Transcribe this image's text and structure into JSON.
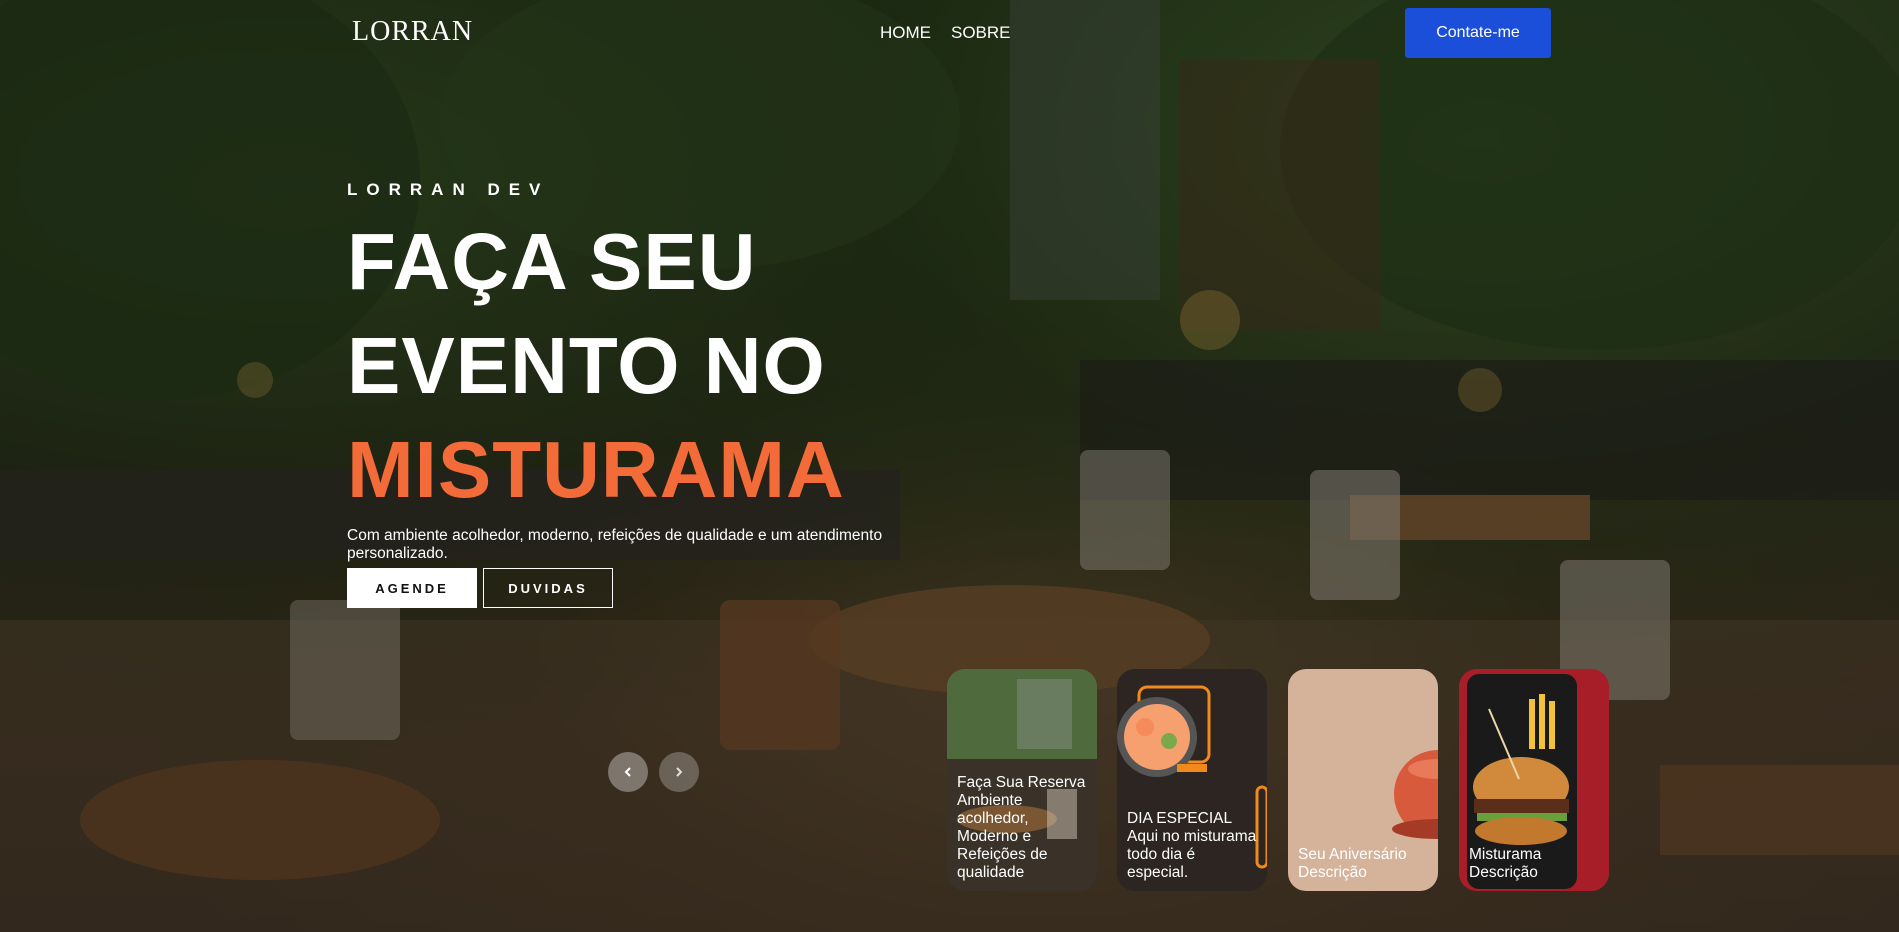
{
  "brand": {
    "logo": "LORRAN"
  },
  "nav": {
    "items": [
      "HOME",
      "SOBRE"
    ],
    "contact_label": "Contate-me"
  },
  "hero": {
    "eyebrow": "LORRAN DEV",
    "headline_line1": "FAÇA SEU",
    "headline_line2": "EVENTO NO",
    "headline_accent": "MISTURAMA",
    "description": "Com ambiente acolhedor, moderno, refeições de qualidade e um atendimento personalizado.",
    "primary_button": "AGENDE",
    "secondary_button": "DUVIDAS"
  },
  "slider": {
    "prev_icon": "chevron-left-icon",
    "next_icon": "chevron-right-icon"
  },
  "cards": [
    {
      "text": "Faça Sua Reserva Ambiente acolhedor, Moderno e Refeições de qualidade",
      "image": "restaurant-interior"
    },
    {
      "text": "DIA ESPECIAL Aqui no misturama todo dia é especial.",
      "image": "salmon-poke-bowl"
    },
    {
      "text": "Seu Aniversário Descrição",
      "image": "birthday-cake"
    },
    {
      "text": "Misturama Descrição",
      "image": "burger-and-fries"
    }
  ],
  "colors": {
    "accent": "#f26b38",
    "contact_button": "#1c4fd9",
    "text": "#ffffff"
  }
}
